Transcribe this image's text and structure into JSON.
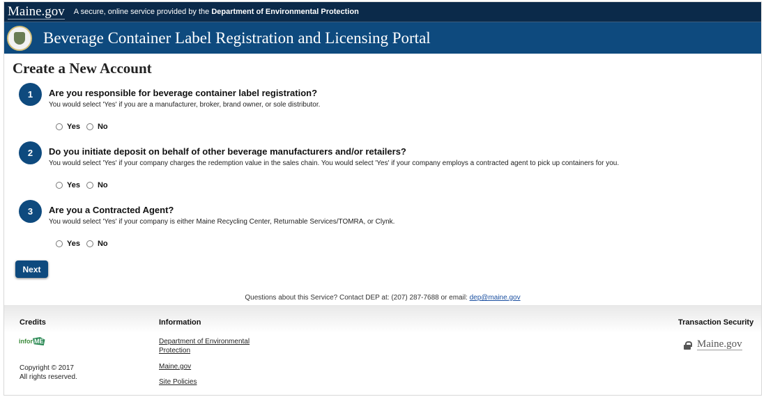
{
  "header": {
    "logo_text": "Maine.gov",
    "tagline_prefix": "A secure, online service provided by the ",
    "tagline_org": "Department of Environmental Protection",
    "portal_title": "Beverage Container Label Registration and Licensing Portal"
  },
  "page_title": "Create a New Account",
  "questions": [
    {
      "number": "1",
      "title": "Are you responsible for beverage container label registration?",
      "help": "You would select 'Yes' if you are a manufacturer, broker, brand owner, or sole distributor.",
      "yes_label": "Yes",
      "no_label": "No"
    },
    {
      "number": "2",
      "title": "Do you initiate deposit on behalf of other beverage manufacturers and/or retailers?",
      "help": "You would select 'Yes' if your company charges the redemption value in the sales chain. You would select 'Yes' if your company employs a contracted agent to pick up containers for you.",
      "yes_label": "Yes",
      "no_label": "No"
    },
    {
      "number": "3",
      "title": "Are you a Contracted Agent?",
      "help": "You would select 'Yes' if your company is either Maine Recycling Center, Returnable Services/TOMRA, or Clynk.",
      "yes_label": "Yes",
      "no_label": "No"
    }
  ],
  "next_label": "Next",
  "contact": {
    "text": "Questions about this Service? Contact DEP at: (207) 287-7688 or email: ",
    "email": "dep@maine.gov"
  },
  "footer": {
    "credits_heading": "Credits",
    "informe_left": "infor",
    "informe_right": "ME",
    "copyright_line1": "Copyright © 2017",
    "copyright_line2": "All rights reserved.",
    "information_heading": "Information",
    "link_dep_line1": "Department of Environmental",
    "link_dep_line2": "Protection",
    "link_maine": "Maine.gov",
    "link_policies": "Site Policies",
    "security_heading": "Transaction Security",
    "security_logo": "Maine.gov"
  },
  "colors": {
    "navy": "#0b2a4a",
    "brand_blue": "#0e4a7e",
    "link_blue": "#1a4fa0"
  }
}
